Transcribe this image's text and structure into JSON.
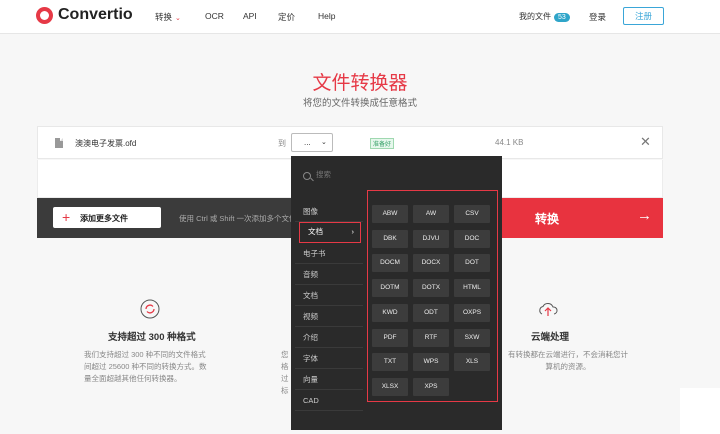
{
  "header": {
    "logo_text": "Convertio",
    "nav": [
      "转换",
      "OCR",
      "API",
      "定价",
      "Help"
    ],
    "my_files": "我的文件",
    "my_files_count": "53",
    "login": "登录",
    "signup": "注册"
  },
  "hero": {
    "title": "文件转换器",
    "subtitle": "将您的文件转换成任意格式"
  },
  "file": {
    "name": "澳澳电子发票.ofd",
    "to_label": "到",
    "target_format": "...",
    "status": "准备好",
    "size": "44.1 KB"
  },
  "actions": {
    "add_more": "添加更多文件",
    "hint": "使用 Ctrl 或 Shift 一次添加多个文件",
    "convert": "转换"
  },
  "features": [
    {
      "title": "支持超过 300 种格式",
      "text": [
        "我们支持超过 300 种不同的文件格式",
        "间超过 25600 种不同的转换方式。数",
        "量全面超越其他任何转换器。"
      ]
    },
    {
      "title": "云端处理",
      "text": [
        "有转换都在云端进行，不会消耗您计",
        "算机的资源。"
      ]
    }
  ],
  "partial_feature_chars": [
    "您",
    "格",
    "过",
    "标"
  ],
  "dropdown": {
    "search_placeholder": "搜索",
    "categories": [
      "图像",
      "文档",
      "电子书",
      "音频",
      "文档",
      "视频",
      "介绍",
      "字体",
      "向量",
      "CAD"
    ],
    "active_category_index": 1,
    "formats": [
      "ABW",
      "AW",
      "CSV",
      "DBK",
      "DJVU",
      "DOC",
      "DOCM",
      "DOCX",
      "DOT",
      "DOTM",
      "DOTX",
      "HTML",
      "KWD",
      "ODT",
      "OXPS",
      "PDF",
      "RTF",
      "SXW",
      "TXT",
      "WPS",
      "XLS",
      "XLSX",
      "XPS"
    ]
  },
  "colors": {
    "brand": "#e63946",
    "convert_button": "#e8333f",
    "dropdown_bg": "#2a2a2a"
  }
}
